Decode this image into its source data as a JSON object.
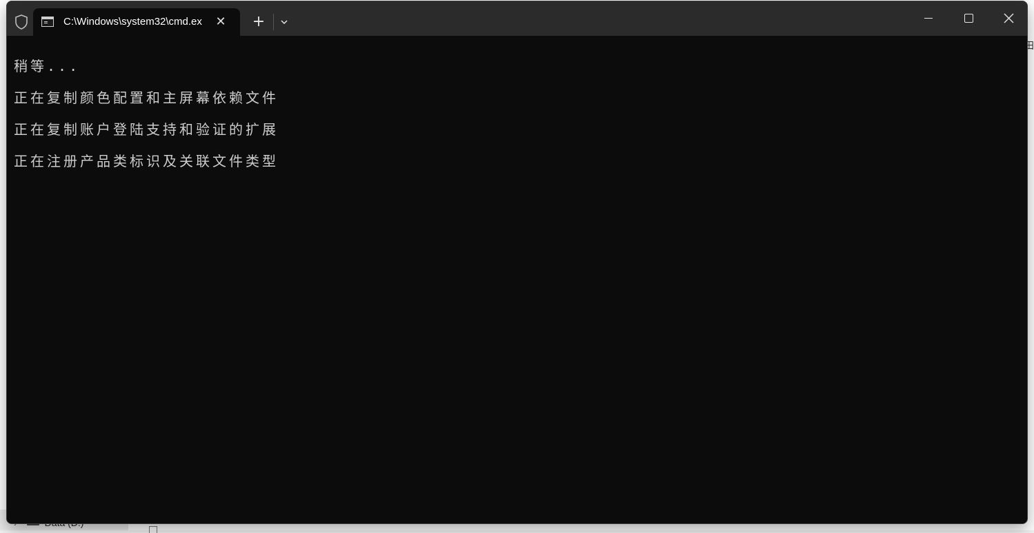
{
  "background": {
    "drive_label": "Data (D:)",
    "right_glyph": "田"
  },
  "window": {
    "tab_title": "C:\\Windows\\system32\\cmd.ex",
    "icons": {
      "shield": "shield-icon",
      "terminal": "terminal-icon",
      "close_tab": "close-icon",
      "new_tab": "plus-icon",
      "dropdown": "chevron-down-icon",
      "minimize": "minimize-icon",
      "maximize": "maximize-icon",
      "close_window": "close-icon"
    },
    "tab_close_glyph": "✕",
    "new_tab_glyph": "+"
  },
  "console": {
    "lines": [
      "稍等...",
      "正在复制颜色配置和主屏幕依赖文件",
      "正在复制账户登陆支持和验证的扩展",
      "正在注册产品类标识及关联文件类型"
    ]
  },
  "colors": {
    "console_bg": "#0c0c0c",
    "console_text": "#cccccc",
    "titlebar_bg": "#2b2b2b"
  }
}
